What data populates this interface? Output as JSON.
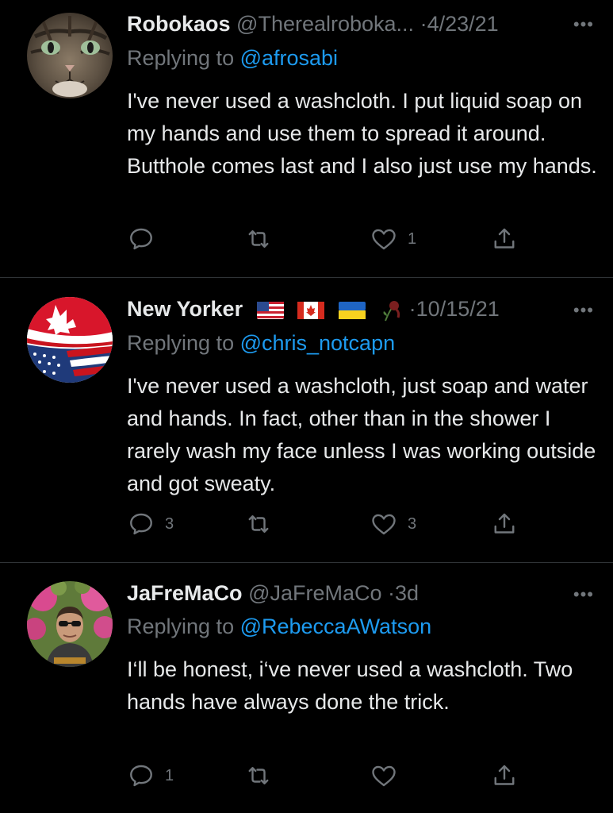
{
  "tweets": [
    {
      "name": "Robokaos",
      "handle": "@Therealroboka...",
      "dot": "·",
      "date": "4/23/21",
      "more": "•••",
      "replying_prefix": "Replying to ",
      "replying_to": "@afrosabi",
      "text": "I've never used a washcloth. I put liquid soap on my hands and use them to spread it around. Butthole comes last and I also just use my hands.",
      "reply_count": "",
      "retweet_count": "",
      "like_count": "1",
      "avatar": "cat-face-photo"
    },
    {
      "name": "New Yorker",
      "handle": "",
      "dot": "·",
      "date": "10/15/21",
      "more": "•••",
      "replying_prefix": "Replying to ",
      "replying_to": "@chris_notcapn",
      "text": "I've never used a washcloth, just soap and water and hands. In fact, other than in the shower I rarely wash my face unless I was working outside and got sweaty.",
      "reply_count": "3",
      "retweet_count": "",
      "like_count": "3",
      "avatar": "us-canada-flags-photo",
      "emojis": [
        "us-flag-icon",
        "canada-flag-icon",
        "ukraine-flag-icon",
        "wilted-rose-icon"
      ]
    },
    {
      "name": "JaFreMaCo",
      "handle": "@JaFreMaCo",
      "dot": "·",
      "date": "3d",
      "more": "•••",
      "replying_prefix": "Replying to ",
      "replying_to": "@RebeccaAWatson",
      "text": "I‘ll be honest, i‘ve never used a washcloth. Two hands have always done the trick.",
      "reply_count": "1",
      "retweet_count": "",
      "like_count": "",
      "avatar": "man-with-sunglasses-photo"
    }
  ],
  "colors": {
    "background": "#000000",
    "text": "#e7e9ea",
    "muted": "#71767b",
    "link": "#1d9bf0",
    "divider": "#2f3336"
  }
}
